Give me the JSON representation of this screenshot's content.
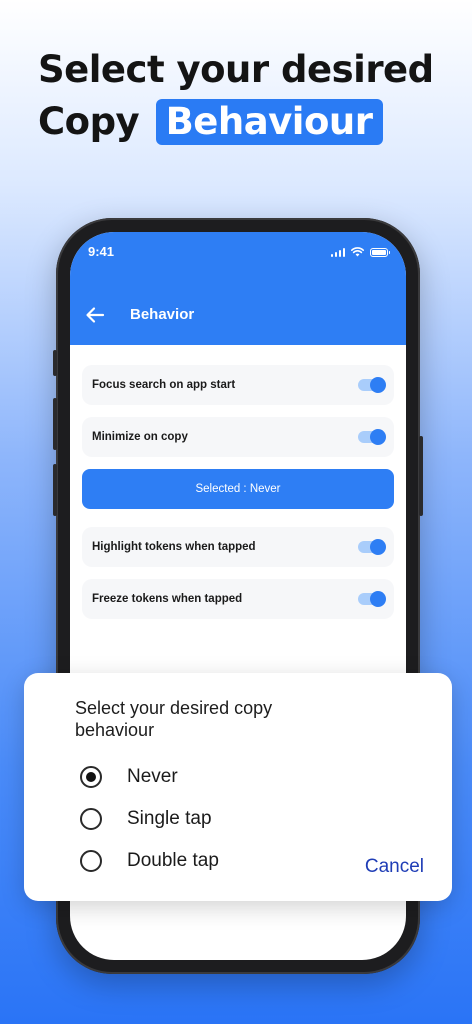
{
  "headline": {
    "line1": "Select your desired",
    "line2_plain": "Copy",
    "line2_highlight": "Behaviour"
  },
  "status_bar": {
    "time": "9:41"
  },
  "app_bar": {
    "title": "Behavior",
    "back_icon": "arrow-left-icon"
  },
  "settings": {
    "rows_top": [
      {
        "label": "Focus search on app start",
        "enabled": true
      },
      {
        "label": "Minimize on copy",
        "enabled": true
      }
    ],
    "selected_button": "Selected : Never",
    "rows_bottom": [
      {
        "label": "Highlight tokens when tapped",
        "enabled": true
      },
      {
        "label": "Freeze tokens when tapped",
        "enabled": true
      }
    ]
  },
  "dialog": {
    "title": "Select your desired copy behaviour",
    "options": [
      {
        "label": "Never",
        "selected": true
      },
      {
        "label": "Single tap",
        "selected": false
      },
      {
        "label": "Double tap",
        "selected": false
      }
    ],
    "cancel_label": "Cancel"
  },
  "colors": {
    "accent": "#2e7ef4",
    "toggle_track": "#a9cdfb",
    "cancel_text": "#1f3db6",
    "headline_text": "#141414"
  }
}
